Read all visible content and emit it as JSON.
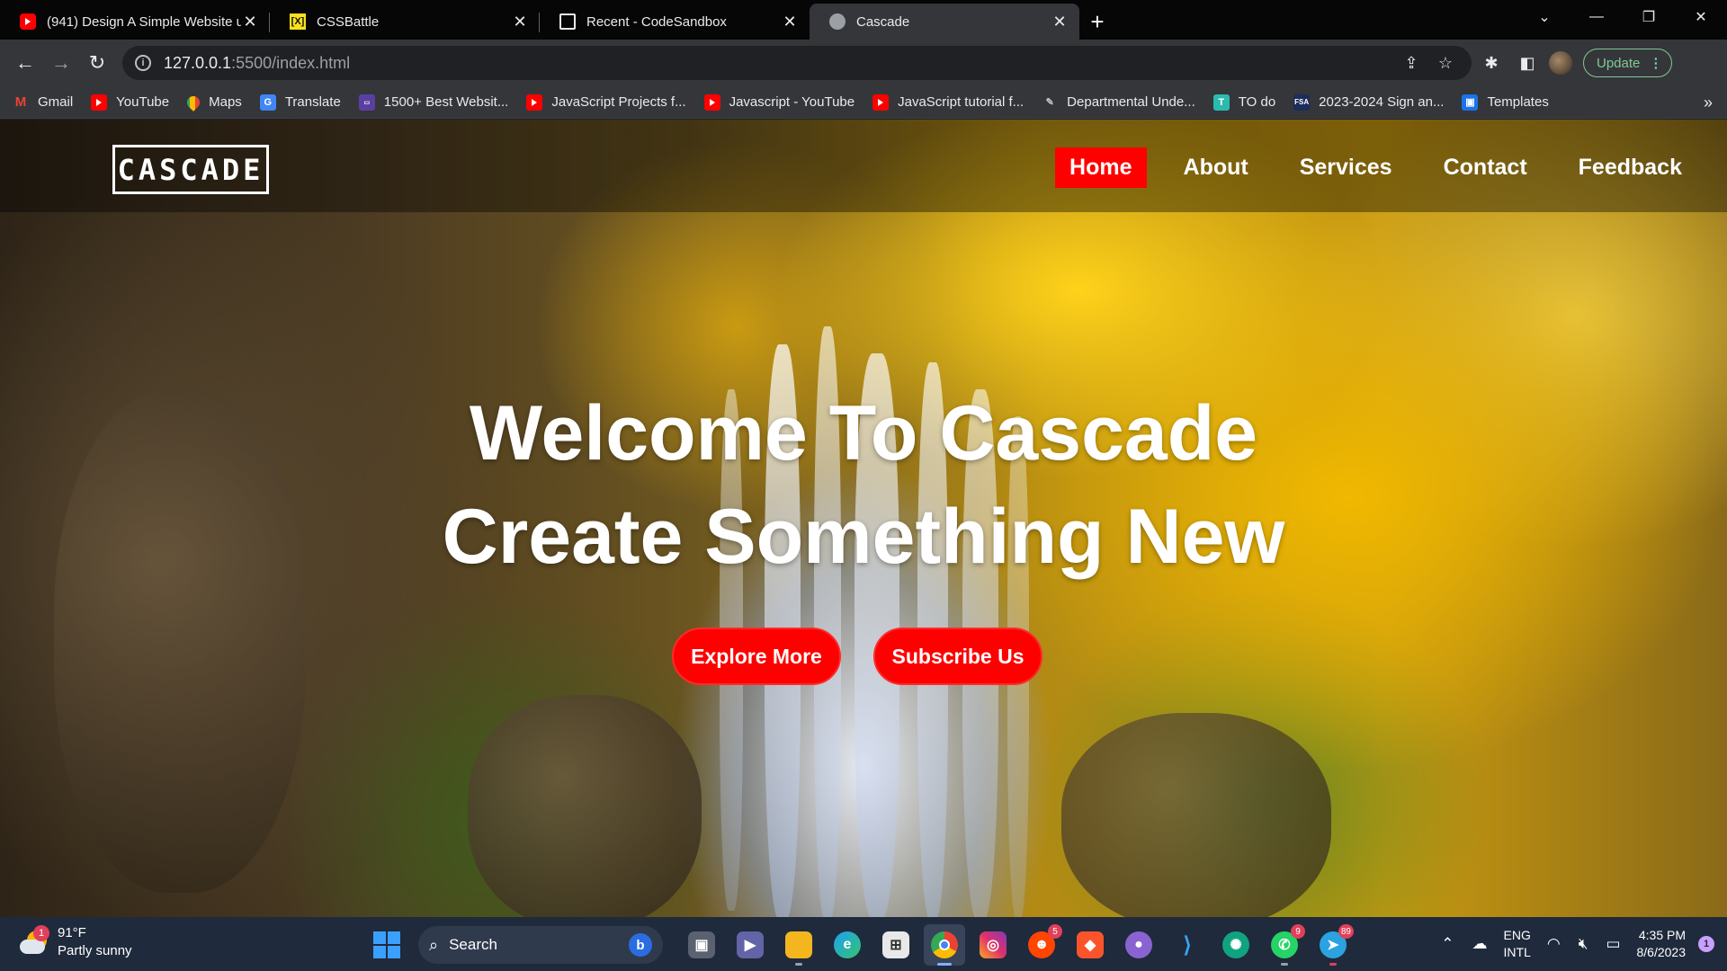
{
  "browser": {
    "tabs": [
      {
        "title": "(941) Design A Simple Website u",
        "favicon": "youtube-icon"
      },
      {
        "title": "CSSBattle",
        "favicon": "cssbattle-icon"
      },
      {
        "title": "Recent - CodeSandbox",
        "favicon": "codesandbox-icon"
      },
      {
        "title": "Cascade",
        "favicon": "globe-icon",
        "active": true
      }
    ],
    "url_host": "127.0.0.1",
    "url_path": ":5500/index.html",
    "update_label": "Update",
    "bookmarks": [
      {
        "label": "Gmail",
        "icon": "gmail-icon"
      },
      {
        "label": "YouTube",
        "icon": "youtube-icon"
      },
      {
        "label": "Maps",
        "icon": "maps-icon"
      },
      {
        "label": "Translate",
        "icon": "translate-icon"
      },
      {
        "label": "1500+ Best Websit...",
        "icon": "site-icon"
      },
      {
        "label": "JavaScript Projects f...",
        "icon": "youtube-icon"
      },
      {
        "label": "Javascript - YouTube",
        "icon": "youtube-icon"
      },
      {
        "label": "JavaScript tutorial f...",
        "icon": "youtube-icon"
      },
      {
        "label": "Departmental Unde...",
        "icon": "dept-icon"
      },
      {
        "label": "TO do",
        "icon": "todo-icon"
      },
      {
        "label": "2023-2024 Sign an...",
        "icon": "fsa-icon"
      },
      {
        "label": "Templates",
        "icon": "templates-icon"
      }
    ]
  },
  "site": {
    "logo": "CASCADE",
    "nav": [
      "Home",
      "About",
      "Services",
      "Contact",
      "Feedback"
    ],
    "active_nav": "Home",
    "hero_line1": "Welcome To Cascade",
    "hero_line2": "Create Something New",
    "cta_primary": "Explore More",
    "cta_secondary": "Subscribe Us",
    "accent_color": "#ff0000"
  },
  "taskbar": {
    "weather_badge": "1",
    "temperature": "91°F",
    "condition": "Partly sunny",
    "search_placeholder": "Search",
    "badges": {
      "reddit": "5",
      "whatsapp": "9",
      "telegram": "89"
    },
    "lang1": "ENG",
    "lang2": "INTL",
    "time": "4:35 PM",
    "date": "8/6/2023",
    "notifications": "1"
  }
}
